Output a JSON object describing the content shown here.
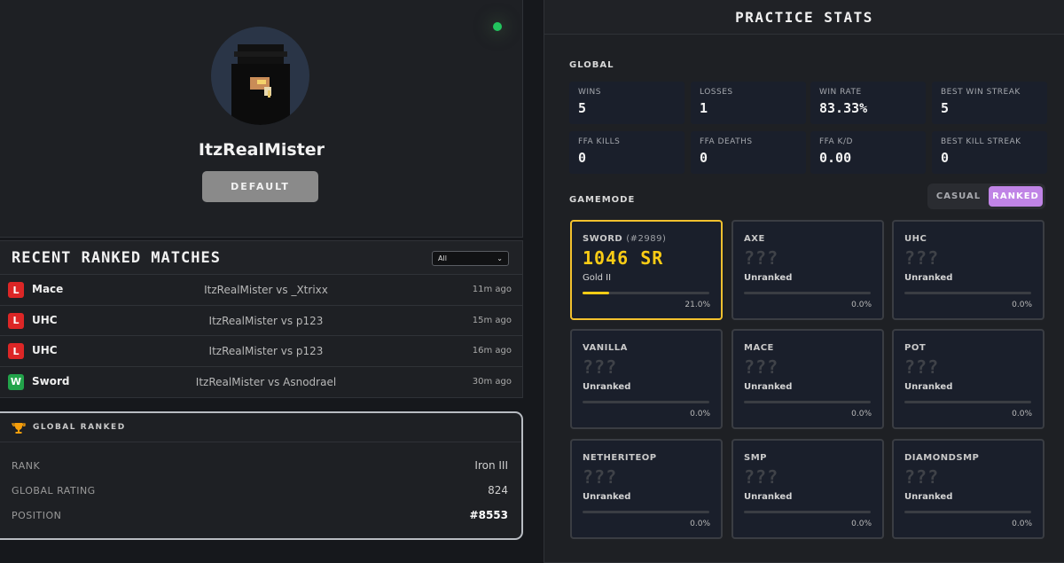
{
  "profile": {
    "username": "ItzRealMister",
    "default_button": "DEFAULT",
    "status_color": "#22c55e"
  },
  "recent_matches": {
    "title": "RECENT RANKED MATCHES",
    "filter_value": "All",
    "rows": [
      {
        "result": "L",
        "mode": "Mace",
        "players": "ItzRealMister vs _Xtrixx",
        "time": "11m ago"
      },
      {
        "result": "L",
        "mode": "UHC",
        "players": "ItzRealMister vs p123",
        "time": "15m ago"
      },
      {
        "result": "L",
        "mode": "UHC",
        "players": "ItzRealMister vs p123",
        "time": "16m ago"
      },
      {
        "result": "W",
        "mode": "Sword",
        "players": "ItzRealMister vs Asnodrael",
        "time": "30m ago"
      }
    ]
  },
  "global_ranked": {
    "title": "GLOBAL RANKED",
    "rank_label": "RANK",
    "rank_value": "Iron III",
    "rating_label": "GLOBAL RATING",
    "rating_value": "824",
    "position_label": "POSITION",
    "position_value": "#8553"
  },
  "practice": {
    "title": "PRACTICE STATS",
    "global_label": "GLOBAL",
    "global_stats": [
      {
        "label": "WINS",
        "value": "5"
      },
      {
        "label": "LOSSES",
        "value": "1"
      },
      {
        "label": "WIN RATE",
        "value": "83.33%"
      },
      {
        "label": "BEST WIN STREAK",
        "value": "5"
      },
      {
        "label": "FFA KILLS",
        "value": "0"
      },
      {
        "label": "FFA DEATHS",
        "value": "0"
      },
      {
        "label": "FFA K/D",
        "value": "0.00"
      },
      {
        "label": "BEST KILL STREAK",
        "value": "0"
      }
    ],
    "gamemode_label": "GAMEMODE",
    "toggle": {
      "casual": "CASUAL",
      "ranked": "RANKED",
      "selected": "RANKED"
    },
    "modes": [
      {
        "name": "SWORD",
        "position": "(#2989)",
        "sr": "1046 SR",
        "rank": "Gold II",
        "progress": 0.21,
        "pct": "21.0%"
      },
      {
        "name": "AXE",
        "position": "",
        "sr": "???",
        "rank": "Unranked",
        "progress": 0,
        "pct": "0.0%"
      },
      {
        "name": "UHC",
        "position": "",
        "sr": "???",
        "rank": "Unranked",
        "progress": 0,
        "pct": "0.0%"
      },
      {
        "name": "VANILLA",
        "position": "",
        "sr": "???",
        "rank": "Unranked",
        "progress": 0,
        "pct": "0.0%"
      },
      {
        "name": "MACE",
        "position": "",
        "sr": "???",
        "rank": "Unranked",
        "progress": 0,
        "pct": "0.0%"
      },
      {
        "name": "POT",
        "position": "",
        "sr": "???",
        "rank": "Unranked",
        "progress": 0,
        "pct": "0.0%"
      },
      {
        "name": "NETHERITEOP",
        "position": "",
        "sr": "???",
        "rank": "Unranked",
        "progress": 0,
        "pct": "0.0%"
      },
      {
        "name": "SMP",
        "position": "",
        "sr": "???",
        "rank": "Unranked",
        "progress": 0,
        "pct": "0.0%"
      },
      {
        "name": "DIAMONDSMP",
        "position": "",
        "sr": "???",
        "rank": "Unranked",
        "progress": 0,
        "pct": "0.0%"
      }
    ]
  }
}
